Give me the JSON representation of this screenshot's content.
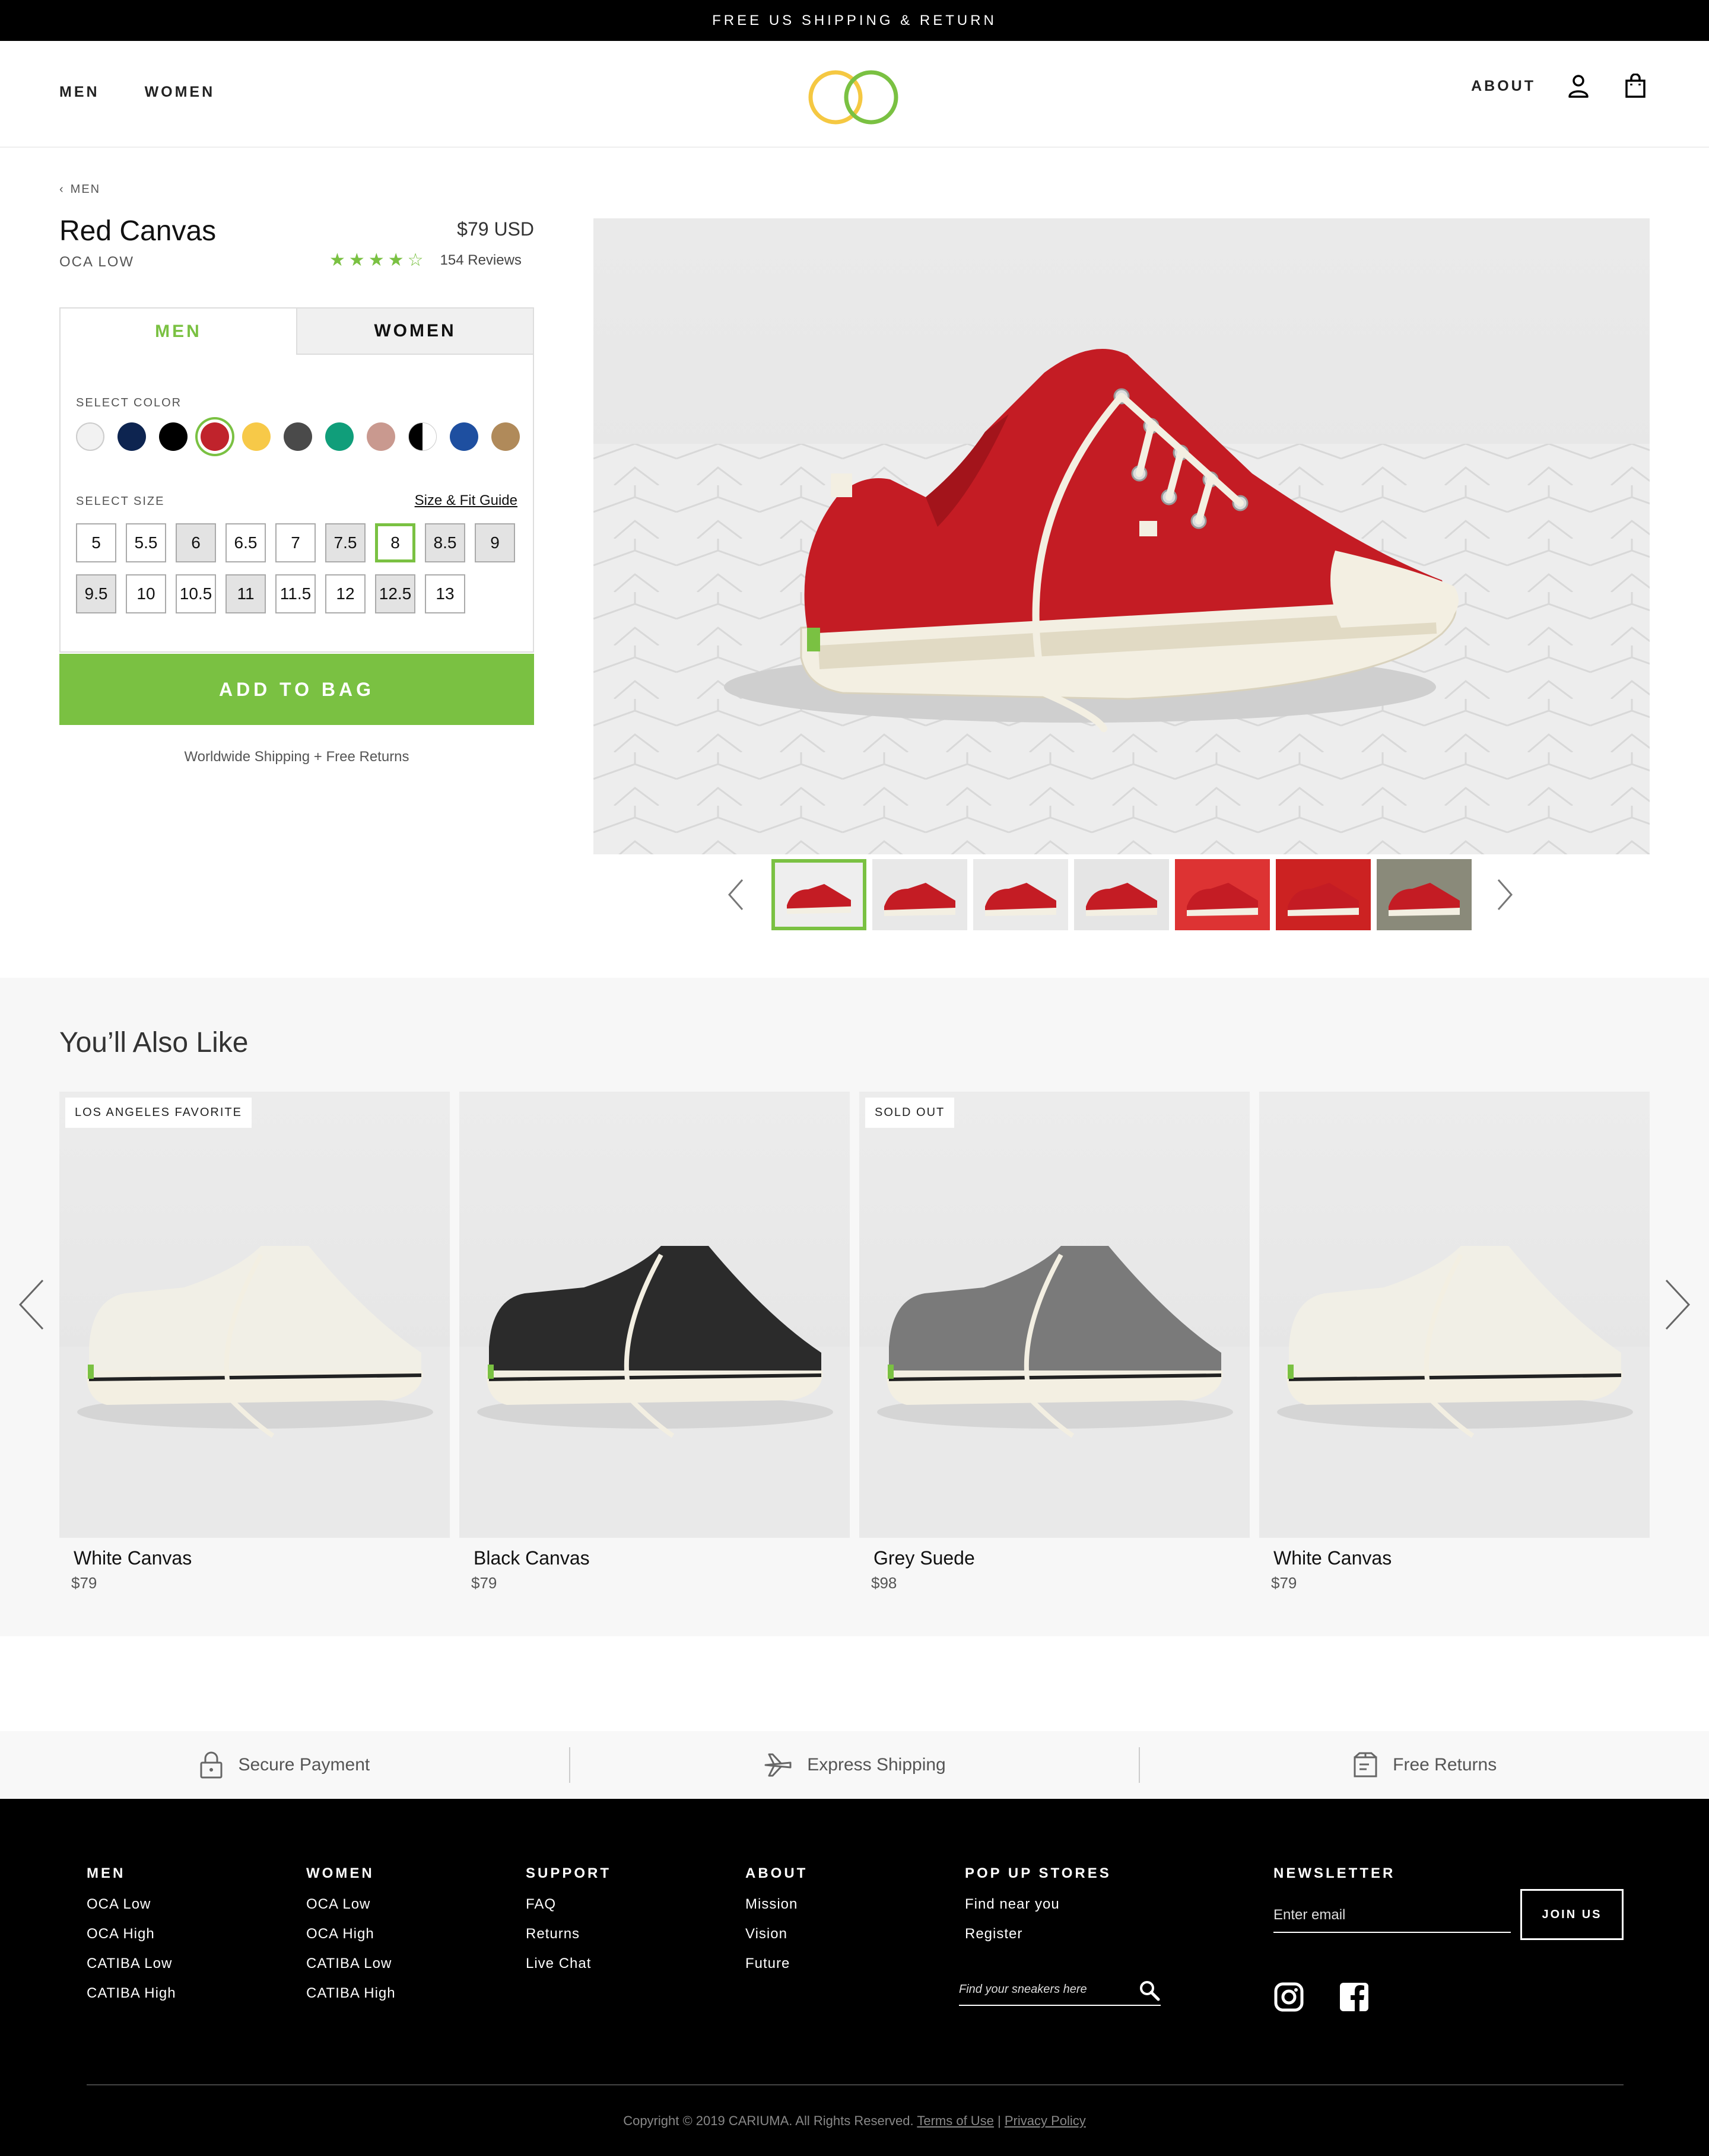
{
  "announcement": "FREE US SHIPPING & RETURN",
  "nav": {
    "left": [
      "MEN",
      "WOMEN"
    ],
    "about": "ABOUT",
    "account_icon": "user-icon",
    "bag_icon": "shopping-bag-icon"
  },
  "logo": {
    "name": "cariuma-rings-logo",
    "colors": [
      "#f5c842",
      "#7ac142"
    ]
  },
  "breadcrumb": "MEN",
  "product": {
    "title": "Red Canvas",
    "subtitle": "OCA LOW",
    "price": "$79 USD",
    "rating": 4,
    "rating_max": 5,
    "reviews": "154 Reviews"
  },
  "selector": {
    "tabs": [
      "MEN",
      "WOMEN"
    ],
    "active_tab": "MEN",
    "color_label": "SELECT COLOR",
    "colors": [
      {
        "name": "white",
        "hex": "#f2f2f2"
      },
      {
        "name": "navy",
        "hex": "#0d2450"
      },
      {
        "name": "black",
        "hex": "#000000"
      },
      {
        "name": "red",
        "hex": "#c0232c",
        "selected": true
      },
      {
        "name": "yellow",
        "hex": "#f7c948"
      },
      {
        "name": "grey",
        "hex": "#4a4a4a"
      },
      {
        "name": "green",
        "hex": "#109e7a"
      },
      {
        "name": "rose",
        "hex": "#c9998f"
      },
      {
        "name": "black-white",
        "hex": "#000000"
      },
      {
        "name": "blue",
        "hex": "#1e4fa0"
      },
      {
        "name": "tan",
        "hex": "#b08a5a"
      }
    ],
    "size_label": "SELECT SIZE",
    "size_guide": "Size & Fit Guide",
    "sizes": [
      {
        "v": "5",
        "available": true
      },
      {
        "v": "5.5",
        "available": true
      },
      {
        "v": "6",
        "available": false
      },
      {
        "v": "6.5",
        "available": true
      },
      {
        "v": "7",
        "available": true
      },
      {
        "v": "7.5",
        "available": false
      },
      {
        "v": "8",
        "available": true,
        "selected": true
      },
      {
        "v": "8.5",
        "available": false
      },
      {
        "v": "9",
        "available": false
      },
      {
        "v": "9.5",
        "available": false
      },
      {
        "v": "10",
        "available": true
      },
      {
        "v": "10.5",
        "available": true
      },
      {
        "v": "11",
        "available": false
      },
      {
        "v": "11.5",
        "available": true
      },
      {
        "v": "12",
        "available": true
      },
      {
        "v": "12.5",
        "available": false
      },
      {
        "v": "13",
        "available": true
      }
    ]
  },
  "add_to_bag": "ADD TO BAG",
  "shipping_note": "Worldwide Shipping  +  Free Returns",
  "gallery": {
    "thumbnails": 7,
    "active_index": 0
  },
  "also_like": {
    "title": "You’ll Also Like",
    "products": [
      {
        "name": "White Canvas",
        "price": "$79",
        "badge": "LOS ANGELES FAVORITE",
        "upper": "#f1efe6",
        "stripe": "#222"
      },
      {
        "name": "Black Canvas",
        "price": "$79",
        "badge": "",
        "upper": "#2b2b2b",
        "stripe": "#222"
      },
      {
        "name": "Grey Suede",
        "price": "$98",
        "badge": "SOLD OUT",
        "upper": "#7a7a7a",
        "stripe": "#222"
      },
      {
        "name": "White Canvas",
        "price": "$79",
        "badge": "",
        "upper": "#f1efe6",
        "stripe": "#222"
      }
    ]
  },
  "trust": [
    {
      "icon": "lock-icon",
      "label": "Secure Payment"
    },
    {
      "icon": "airplane-icon",
      "label": "Express Shipping"
    },
    {
      "icon": "box-icon",
      "label": "Free Returns"
    }
  ],
  "footer": {
    "columns": [
      {
        "title": "MEN",
        "links": [
          "OCA Low",
          "OCA High",
          "CATIBA Low",
          "CATIBA High"
        ]
      },
      {
        "title": "WOMEN",
        "links": [
          "OCA Low",
          "OCA High",
          "CATIBA Low",
          "CATIBA High"
        ]
      },
      {
        "title": "SUPPORT",
        "links": [
          "FAQ",
          "Returns",
          "Live Chat"
        ]
      },
      {
        "title": "ABOUT",
        "links": [
          "Mission",
          "Vision",
          "Future"
        ]
      },
      {
        "title": "POP UP STORES",
        "links": [
          "Find near you",
          "Register"
        ]
      }
    ],
    "find_placeholder": "Find your sneakers here",
    "newsletter_title": "NEWSLETTER",
    "email_placeholder": "Enter email",
    "join": "JOIN US",
    "copyright": "Copyright © 2019 CARIUMA. All Rights Reserved.",
    "terms": "Terms of Use",
    "privacy": "Privacy Policy"
  },
  "accent": "#7ac142"
}
